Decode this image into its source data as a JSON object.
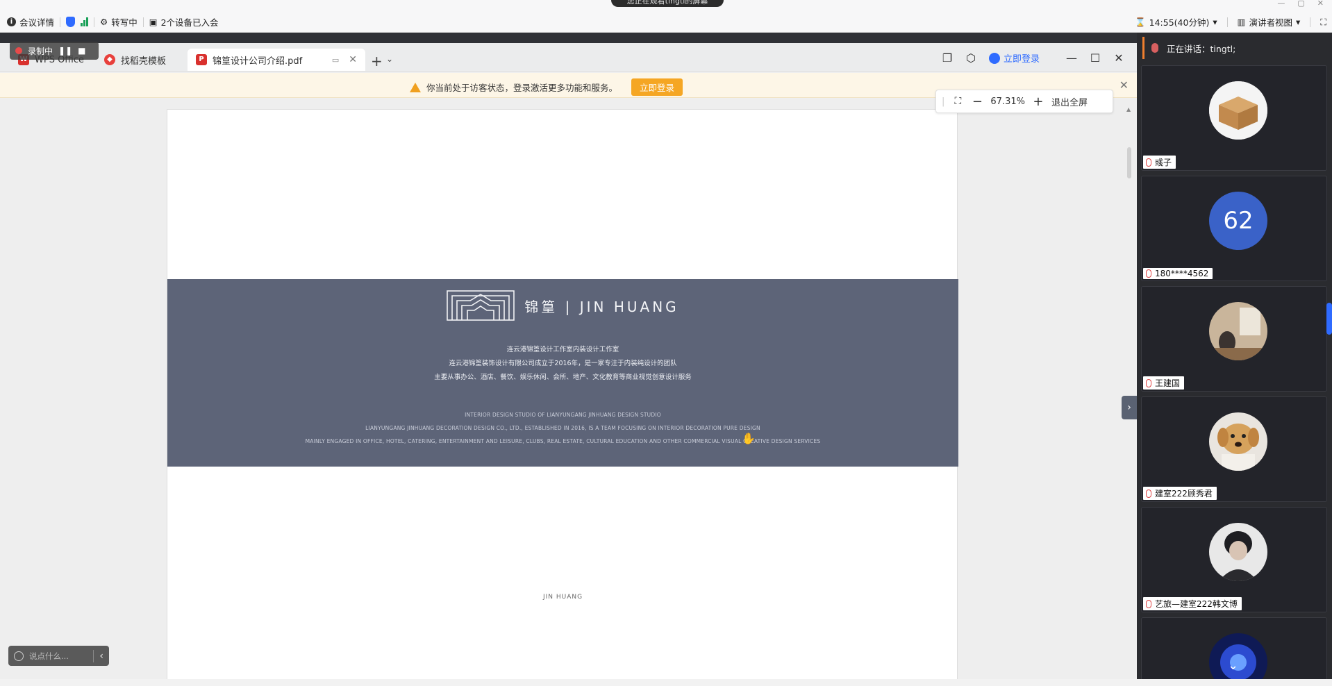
{
  "meeting_bar": {
    "details": "会议详情",
    "transcribing": "转写中",
    "devices": "2个设备已入会",
    "share_status": "您正在观看tingtl的屏幕",
    "time": "14:55(40分钟)",
    "view": "演讲者视图"
  },
  "recording": {
    "label": "录制中"
  },
  "tabs": [
    {
      "label": "WPS Office",
      "icon_color": "#d9312e"
    },
    {
      "label": "找稻壳模板",
      "icon_color": "#e8403c"
    },
    {
      "label": "锦篁设计公司介绍.pdf",
      "icon_color": "#d9312e"
    }
  ],
  "wps": {
    "login": "立即登录"
  },
  "notice": {
    "text": "你当前处于访客状态，登录激活更多功能和服务。",
    "button": "立即登录"
  },
  "zoom": {
    "value": "67.31%",
    "exit": "退出全屏"
  },
  "document": {
    "brand": "锦篁 | JIN HUANG",
    "cn_lines": [
      "连云港锦篁设计工作室内装设计工作室",
      "连云港锦篁装饰设计有限公司成立于2016年，是一家专注于内装纯设计的团队",
      "主要从事办公、酒店、餐饮、娱乐休闲、会所、地产、文化教育等商业视觉创意设计服务"
    ],
    "en_lines": [
      "INTERIOR DESIGN STUDIO OF LIANYUNGANG JINHUANG DESIGN STUDIO",
      "LIANYUNGANG JINHUANG DECORATION DESIGN CO., LTD., ESTABLISHED IN 2016, IS A TEAM FOCUSING ON INTERIOR DECORATION PURE DESIGN",
      "MAINLY ENGAGED IN OFFICE, HOTEL, CATERING, ENTERTAINMENT AND LEISURE, CLUBS, REAL ESTATE, CULTURAL EDUCATION AND OTHER COMMERCIAL VISUAL CREATIVE DESIGN SERVICES"
    ],
    "footer": "JIN HUANG"
  },
  "chat": {
    "placeholder": "说点什么..."
  },
  "panel": {
    "speaking": "正在讲话：tingtl;",
    "participants": [
      {
        "name": "彧子",
        "avatar": "box"
      },
      {
        "name": "180****4562",
        "avatar": "62"
      },
      {
        "name": "王建国",
        "avatar": "vase"
      },
      {
        "name": "建室222顾秀君",
        "avatar": "dog"
      },
      {
        "name": "艺旅—建室222韩文博",
        "avatar": "person"
      },
      {
        "name": "",
        "avatar": "blue"
      }
    ]
  }
}
